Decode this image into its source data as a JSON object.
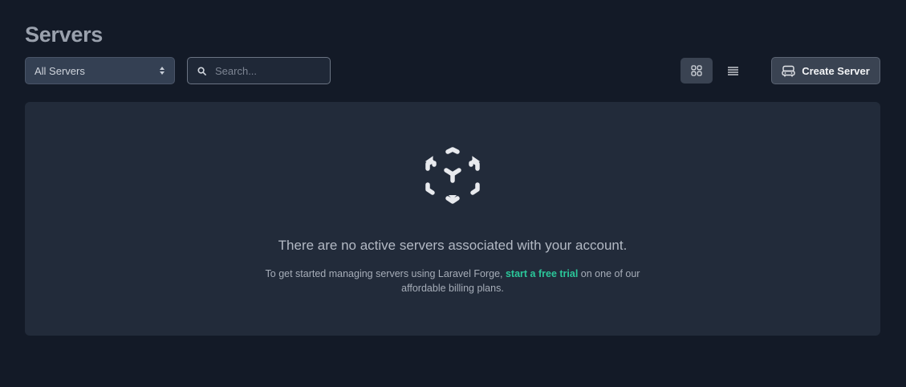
{
  "header": {
    "title": "Servers"
  },
  "toolbar": {
    "filter": {
      "selected": "All Servers",
      "icon": "chevron-updown-icon"
    },
    "search": {
      "placeholder": "Search...",
      "value": "",
      "icon": "search-icon"
    },
    "view_toggle": {
      "active": "grid",
      "grid_icon": "grid-view-icon",
      "list_icon": "list-view-icon"
    },
    "create_button": {
      "label": "Create Server",
      "icon": "server-icon"
    }
  },
  "empty_state": {
    "icon": "cube-icon",
    "title": "There are no active servers associated with your account.",
    "description_before": "To get started managing servers using Laravel Forge, ",
    "link_text": "start a free trial",
    "description_after": " on one of our affordable billing plans."
  },
  "colors": {
    "background": "#131a27",
    "panel": "#222b3a",
    "accent_link": "#2bc79a",
    "button": "#3a4352"
  }
}
